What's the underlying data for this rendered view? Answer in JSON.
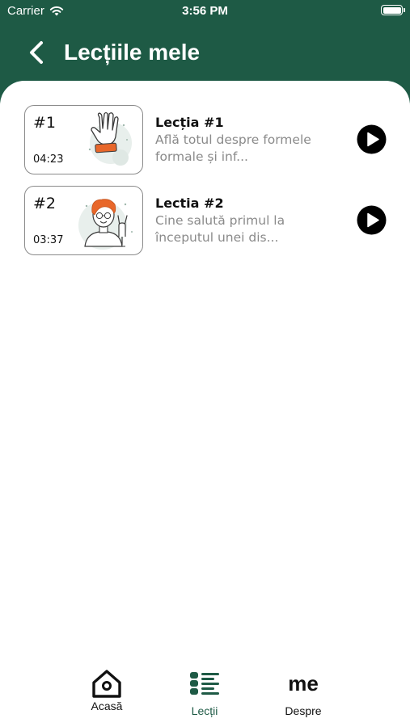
{
  "status_bar": {
    "carrier": "Carrier",
    "time": "3:56 PM"
  },
  "header": {
    "title": "Lecțiile mele"
  },
  "lessons": [
    {
      "number": "#1",
      "duration": "04:23",
      "title": "Lecția #1",
      "description": "Află totul despre formele formale și inf..."
    },
    {
      "number": "#2",
      "duration": "03:37",
      "title": "Lectia #2",
      "description": "Cine salută primul la începutul unei dis..."
    }
  ],
  "tabbar": {
    "tabs": [
      {
        "label": "Acasă",
        "icon": "home-icon"
      },
      {
        "label": "Lecții",
        "icon": "list-icon"
      },
      {
        "label": "Despre",
        "icon": "me-text-icon",
        "icon_text": "me"
      }
    ],
    "active_color": "#1e5a45",
    "inactive_color": "#111111"
  },
  "colors": {
    "brand": "#1e5a45",
    "accent": "#e8672a"
  }
}
